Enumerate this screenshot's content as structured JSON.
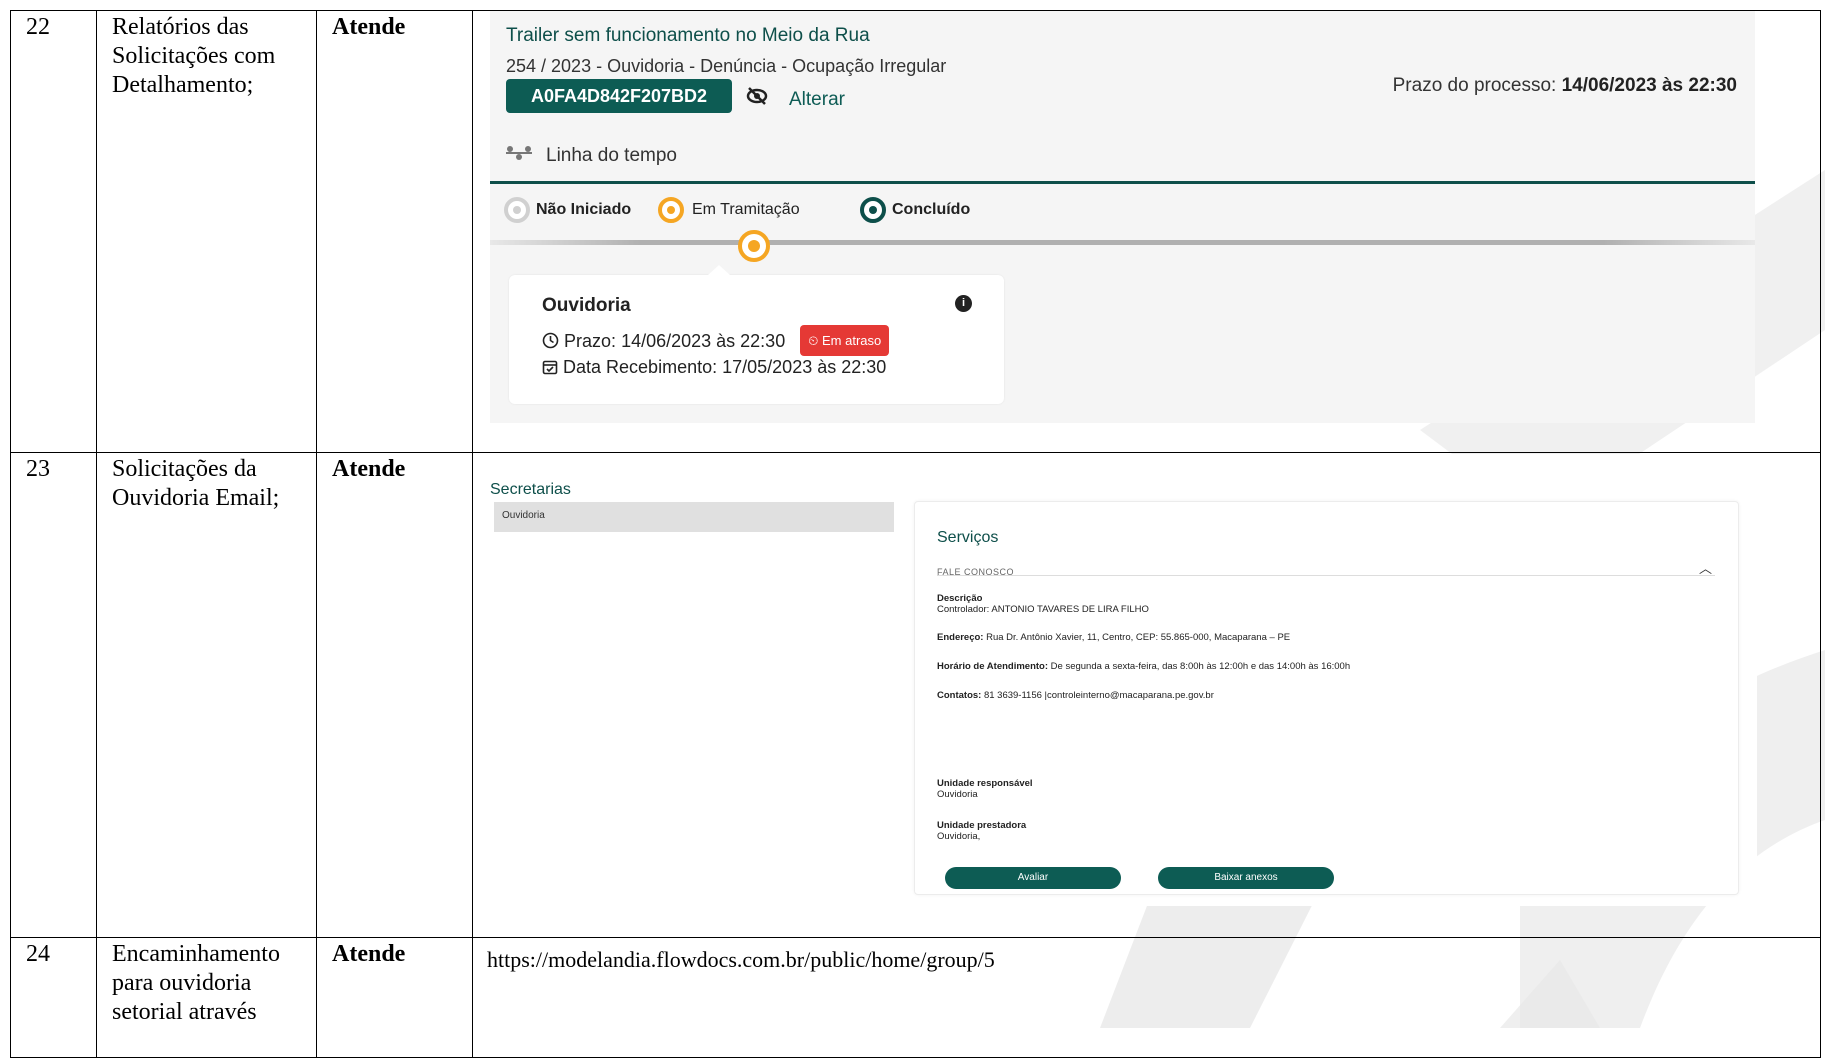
{
  "rows": [
    {
      "num": "22",
      "item": "Relatórios das Solicitações com Detalhamento;",
      "status": "Atende"
    },
    {
      "num": "23",
      "item": "Solicitações da Ouvidoria Email;",
      "status": "Atende"
    },
    {
      "num": "24",
      "item": "Encaminhamento para ouvidoria setorial através",
      "status": "Atende"
    }
  ],
  "row22": {
    "title": "Trailer sem funcionamento no Meio da Rua",
    "subtitle": "254 / 2023 - Ouvidoria - Denúncia - Ocupação Irregular",
    "code": "A0FA4D842F207BD2",
    "alterar": "Alterar",
    "prazo_label": "Prazo do processo:",
    "prazo_value": "14/06/2023 às 22:30",
    "timeline_label": "Linha do tempo",
    "legend": {
      "nao_iniciado": "Não Iniciado",
      "em_tramitacao": "Em Tramitação",
      "concluido": "Concluído"
    },
    "card": {
      "title": "Ouvidoria",
      "prazo_label": "Prazo:",
      "prazo_value": "14/06/2023 às 22:30",
      "badge": "Em atraso",
      "recebimento_label": "Data Recebimento:",
      "recebimento_value": "17/05/2023 às 22:30"
    },
    "colors": {
      "teal": "#0d5c54",
      "orange": "#f5a623",
      "red": "#e53935",
      "grey": "#c8c8c8"
    },
    "icons": {
      "timeline": "timeline-icon",
      "visibility": "eye-off-icon",
      "clock": "clock-icon",
      "calendar": "calendar-icon",
      "info": "info-icon"
    }
  },
  "row23": {
    "secretarias_title": "Secretarias",
    "secretaria_item": "Ouvidoria",
    "servicos_title": "Serviços",
    "accordion_label": "FALE CONOSCO",
    "descricao_label": "Descrição",
    "controlador": "Controlador: ANTONIO TAVARES DE LIRA FILHO",
    "endereco_label": "Endereço:",
    "endereco_value": "Rua Dr. Antônio Xavier, 11, Centro, CEP: 55.865-000, Macaparana – PE",
    "horario_label": "Horário de Atendimento:",
    "horario_value": "De segunda a sexta-feira, das 8:00h às 12:00h e das 14:00h às 16:00h",
    "contatos_label": "Contatos:",
    "contatos_value": "81 3639-1156 |controleinterno@macaparana.pe.gov.br",
    "unidade_resp_label": "Unidade responsável",
    "unidade_resp_value": "Ouvidoria",
    "unidade_prest_label": "Unidade prestadora",
    "unidade_prest_value": "Ouvidoria,",
    "btn_avaliar": "Avaliar",
    "btn_anexos": "Baixar anexos"
  },
  "row24": {
    "url": "https://modelandia.flowdocs.com.br/public/home/group/5"
  }
}
